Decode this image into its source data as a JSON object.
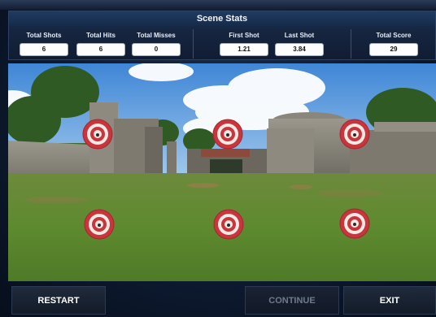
{
  "stats": {
    "title": "Scene Stats",
    "total_shots_label": "Total Shots",
    "total_shots": "6",
    "total_hits_label": "Total Hits",
    "total_hits": "6",
    "total_misses_label": "Total Misses",
    "total_misses": "0",
    "first_shot_label": "First Shot",
    "first_shot": "1.21",
    "last_shot_label": "Last Shot",
    "last_shot": "3.84",
    "total_score_label": "Total Score",
    "total_score": "29"
  },
  "scene": {
    "targets": [
      "target-1",
      "target-2",
      "target-3",
      "target-4",
      "target-5",
      "target-6"
    ]
  },
  "footer": {
    "restart_label": "RESTART",
    "continue_label": "CONTINUE",
    "exit_label": "EXIT"
  },
  "colors": {
    "panel_bg": "#142440",
    "title_bg": "#1f3b62",
    "target_red": "#c8353d",
    "button_bg": "#1a2333"
  }
}
